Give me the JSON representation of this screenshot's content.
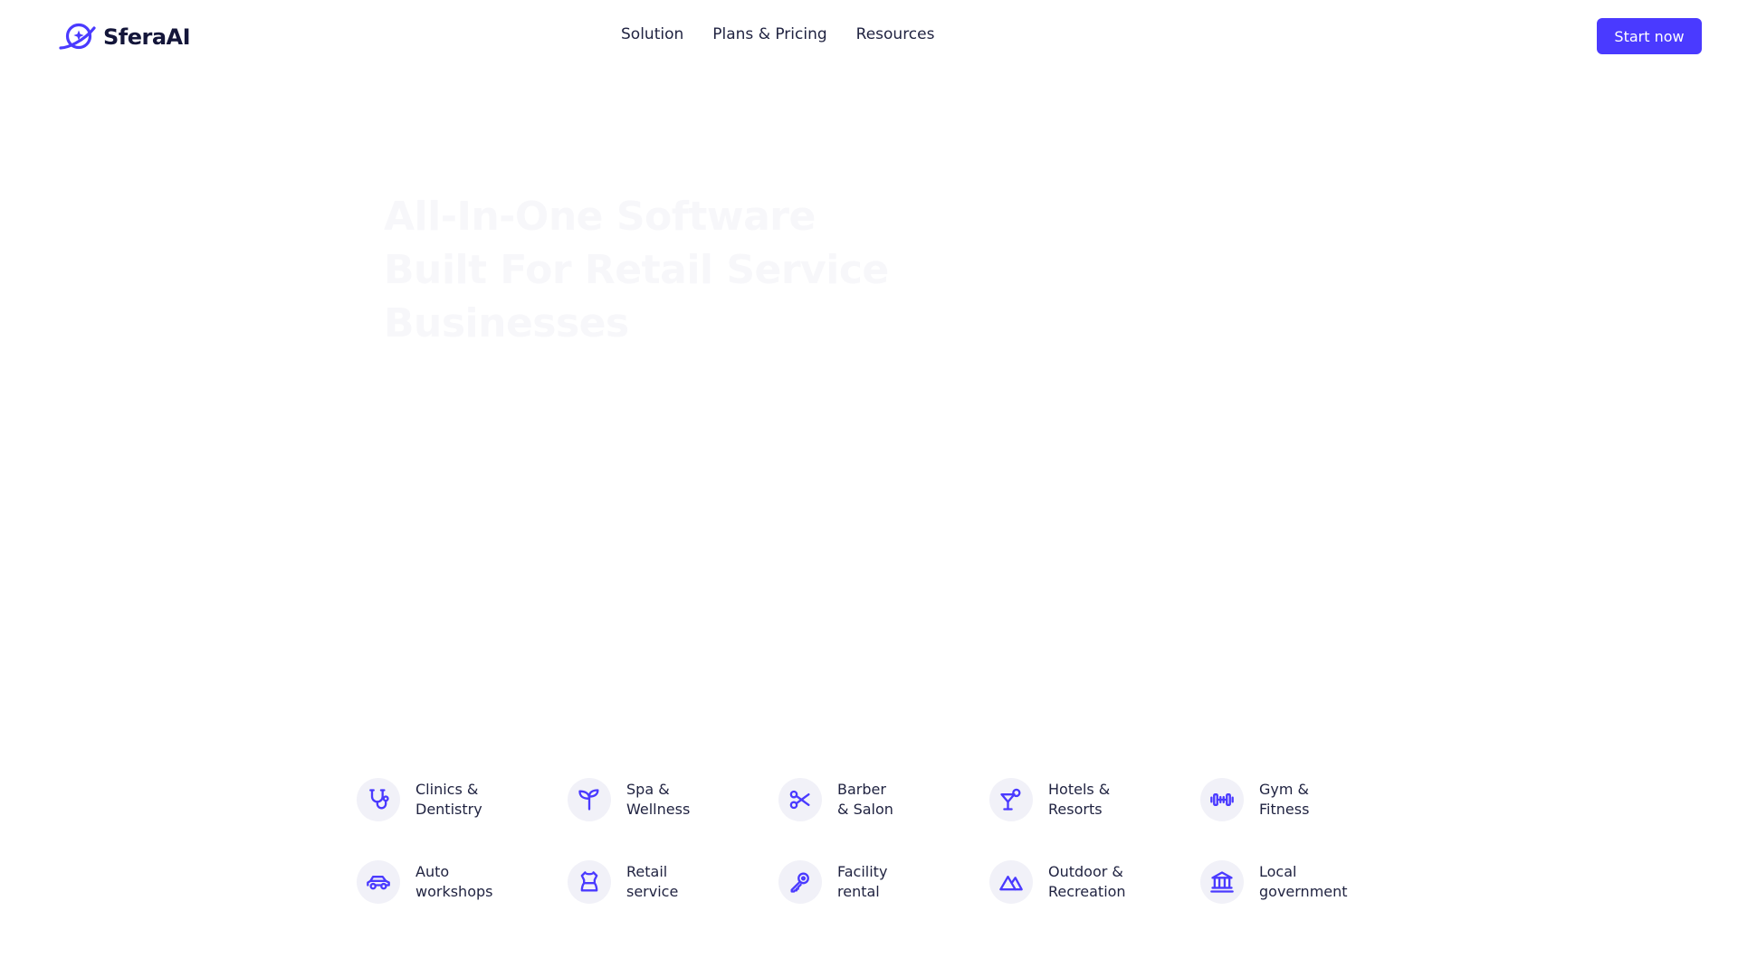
{
  "brand": {
    "name": "SferaAI",
    "accent": "#4a3aff",
    "logo_icon": "planet-orbit-icon"
  },
  "nav": {
    "items": [
      {
        "label": "Solution"
      },
      {
        "label": "Plans & Pricing"
      },
      {
        "label": "Resources"
      }
    ]
  },
  "cta": {
    "label": "Start now"
  },
  "hero": {
    "title": "All-In-One Software Built For Retail Service Businesses",
    "subtitle": "",
    "subtitle_note": "faint, illegible subtitle text under the title"
  },
  "industries": [
    {
      "line1": "Clinics &",
      "line2": "Dentistry",
      "icon": "stethoscope-icon"
    },
    {
      "line1": "Spa &",
      "line2": "Wellness",
      "icon": "sprout-icon"
    },
    {
      "line1": "Barber",
      "line2": "& Salon",
      "icon": "scissors-icon"
    },
    {
      "line1": "Hotels &",
      "line2": "Resorts",
      "icon": "cocktail-icon"
    },
    {
      "line1": "Gym &",
      "line2": "Fitness",
      "icon": "dumbbell-icon"
    },
    {
      "line1": "Auto",
      "line2": "workshops",
      "icon": "car-icon"
    },
    {
      "line1": "Retail",
      "line2": "service",
      "icon": "shirt-icon"
    },
    {
      "line1": "Facility",
      "line2": "rental",
      "icon": "key-icon"
    },
    {
      "line1": "Outdoor &",
      "line2": "Recreation",
      "icon": "mountain-icon"
    },
    {
      "line1": "Local",
      "line2": "government",
      "icon": "government-building-icon"
    }
  ]
}
